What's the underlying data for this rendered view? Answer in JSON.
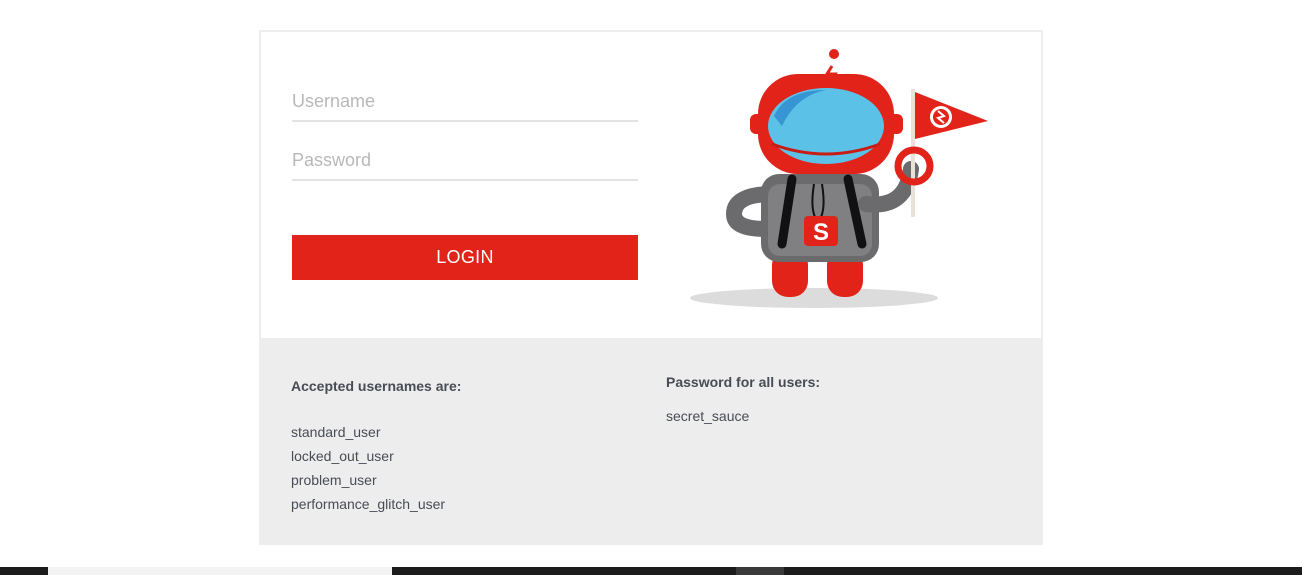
{
  "login": {
    "username_placeholder": "Username",
    "password_placeholder": "Password",
    "button_label": "LOGIN"
  },
  "credentials": {
    "usernames_title": "Accepted usernames are:",
    "usernames": [
      "standard_user",
      "locked_out_user",
      "problem_user",
      "performance_glitch_user"
    ],
    "password_title": "Password for all users:",
    "password": "secret_sauce"
  },
  "colors": {
    "accent": "#e2231a",
    "panel_bg": "#ededed",
    "text": "#484c55"
  },
  "icons": {
    "mascot": "robot-mascot-with-flag"
  }
}
